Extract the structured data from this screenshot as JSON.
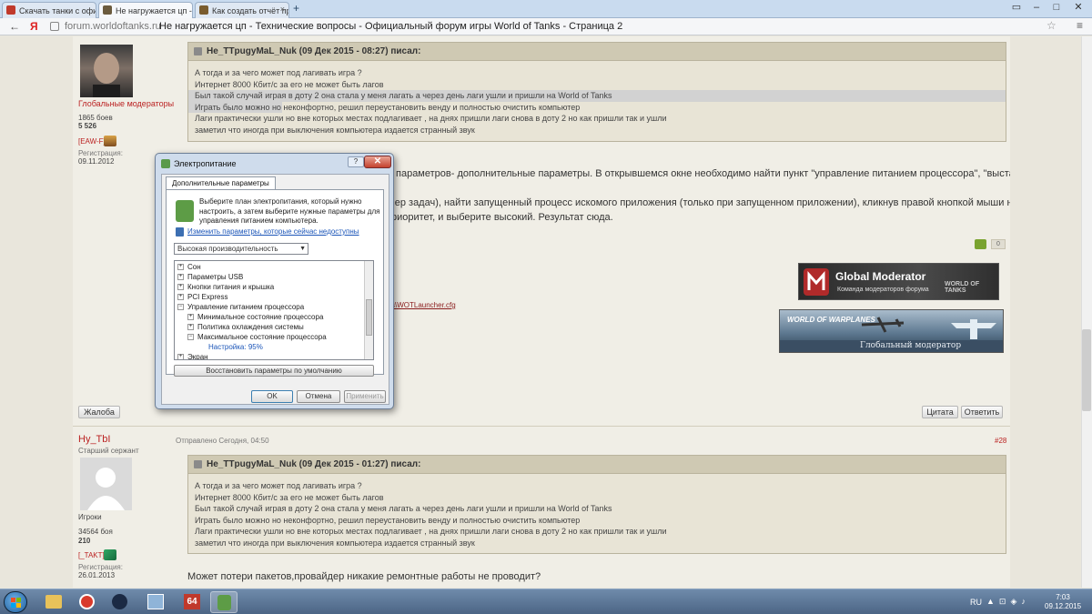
{
  "browser": {
    "tabs": [
      {
        "label": "Скачать танки с офи",
        "favicon_color": "#c0392b",
        "active": false
      },
      {
        "label": "Не нагружается цп -",
        "favicon_color": "#6b5b3e",
        "active": true
      },
      {
        "label": "Как создать отчёт пр",
        "favicon_color": "#7a5c2e",
        "active": false
      }
    ],
    "new_tab_glyph": "+",
    "tab_close_glyph": "×",
    "window_buttons": [
      "▭",
      "‒",
      "□",
      "✕"
    ],
    "back_glyph": "←",
    "yandex_glyph": "Я",
    "domain": "forum.worldoftanks.ru",
    "page_title": "Не нагружается цп - Технические вопросы - Официальный форум игры World of Tanks - Страница 2",
    "star_glyph": "☆",
    "menu_glyph": "≡"
  },
  "post1": {
    "user_group": "Глобальные модераторы",
    "battles": "1865 боев",
    "posts": "5  526",
    "clan_tag": "[EAW-F]",
    "reg_label": "Регистрация:",
    "reg_date": "09.11.2012",
    "quote": {
      "header": "He_TTpugyMaL_Nuk (09 Дек 2015 - 08:27) писал:",
      "lines": [
        "А тогда и за чего может под лагивать  игра ?",
        "Интернет 8000 Кбит/с за его не может быть лагов",
        "Был такой случай играя в доту 2 она стала у меня лагать а через день лаги ушли и пришли на World of Tanks",
        "Играть было можно но неконфортно, решил переустановить венду и полностью очистить компьютер",
        "Лаги практически ушли но вне которых местах подлагивает , на днях пришли лаги снова в доту 2 но как пришли так и ушли",
        "заметил что иногда при выключения компьютера издается странный звук"
      ]
    },
    "body_line1": "параметров- дополнительные параметры. В открывшемся окне необходимо найти пункт \"управление питанием процессора\", \"выставьте",
    "body_line2": "чер задач), найти запущенный процесс искомого приложения (только при запущенном приложении), кликнув правой кнопкой мыши на нём, в",
    "body_line3": "риоритет, и выберите высокий. Результат сюда.",
    "vote_count": "0",
    "link_fragment": "s\\WOTLauncher.cfg",
    "banner1_title": "Global Moderator",
    "banner1_sub": "Команда модераторов форума",
    "banner1_logo": "WORLD OF TANKS",
    "banner2_logo": "WORLD OF WARPLANES",
    "banner2_sub": "Глобальный модератор",
    "complaint_btn": "Жалоба",
    "quote_btn": "Цитата",
    "reply_btn": "Ответить"
  },
  "post2": {
    "username": "Hy_TbI",
    "rank": "Старший сержант",
    "sent_label": "Отправлено Сегодня, 04:50",
    "post_number": "#28",
    "user_group": "Игроки",
    "battles": "34564 боя",
    "posts": "210",
    "clan_tag": "[_TAKT]",
    "reg_label": "Регистрация:",
    "reg_date": "26.01.2013",
    "quote": {
      "header": "He_TTpugyMaL_Nuk (09 Дек 2015 - 01:27) писал:",
      "lines": [
        "А тогда и за чего может под лагивать  игра ?",
        "Интернет 8000 Кбит/с за его не может быть лагов",
        "Был такой случай играя в доту 2 она стала у меня лагать а через день лаги ушли и пришли на World of Tanks",
        "Играть было можно но неконфортно, решил переустановить венду и полностью очистить компьютер",
        "Лаги практически ушли но вне которых местах подлагивает , на днях пришли лаги снова в доту 2 но как пришли так и ушли",
        "заметил что иногда при выключения компьютера издается странный звук"
      ]
    },
    "body": "Может потери пакетов,провайдер никакие ремонтные работы не проводит?"
  },
  "dialog": {
    "title": "Электропитание",
    "help_glyph": "?",
    "close_glyph": "✕",
    "tab": "Дополнительные параметры",
    "description": "Выберите план электропитания, который нужно настроить, а затем выберите нужные параметры для управления питанием компьютера.",
    "link": "Изменить параметры, которые сейчас недоступны",
    "plan_select": "Высокая производительность",
    "select_arrow": "▼",
    "tree": [
      {
        "sign": "+",
        "label": "Сон",
        "indent": 0
      },
      {
        "sign": "+",
        "label": "Параметры USB",
        "indent": 0
      },
      {
        "sign": "+",
        "label": "Кнопки питания и крышка",
        "indent": 0
      },
      {
        "sign": "+",
        "label": "PCI Express",
        "indent": 0
      },
      {
        "sign": "−",
        "label": "Управление питанием процессора",
        "indent": 0
      },
      {
        "sign": "+",
        "label": "Минимальное состояние процессора",
        "indent": 1
      },
      {
        "sign": "+",
        "label": "Политика охлаждения системы",
        "indent": 1
      },
      {
        "sign": "−",
        "label": "Максимальное состояние процессора",
        "indent": 1
      },
      {
        "sign": "",
        "label": "Настройка: 95%",
        "indent": 2
      },
      {
        "sign": "+",
        "label": "Экран",
        "indent": 0
      }
    ],
    "restore_btn": "Восстановить параметры по умолчанию",
    "ok_btn": "OK",
    "cancel_btn": "Отмена",
    "apply_btn": "Применить"
  },
  "taskbar": {
    "apps": [
      {
        "name": "explorer",
        "color": "#e8c25a",
        "active": false
      },
      {
        "name": "yandex",
        "color": "#d93a2b",
        "active": false
      },
      {
        "name": "steam",
        "color": "#1b2a44",
        "active": false
      },
      {
        "name": "network",
        "color": "#8fb4d8",
        "active": false
      },
      {
        "name": "aida64",
        "color": "#c0392b",
        "active": false
      },
      {
        "name": "power",
        "color": "#5d9c46",
        "active": true
      }
    ],
    "aida_label": "64",
    "lang": "RU",
    "tray_glyphs": "▲⊡◈♪",
    "time": "7:03",
    "date": "09.12.2015"
  },
  "colors": {
    "accent_red": "#b22222",
    "link_blue": "#1b55b8",
    "quote_bg": "#e8e4d6"
  }
}
